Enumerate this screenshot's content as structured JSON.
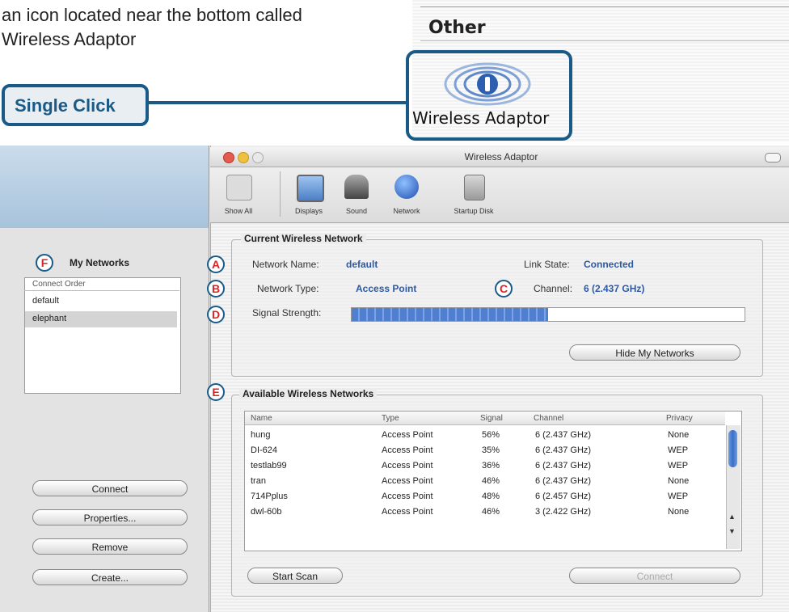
{
  "instruction": {
    "line1": "an icon located near the bottom called",
    "line2": "Wireless Adaptor"
  },
  "callout": {
    "label": "Single Click"
  },
  "inset": {
    "section_title": "Other",
    "icon_label": "Wireless Adaptor",
    "icon_name": "wireless-adaptor-icon"
  },
  "window": {
    "title": "Wireless Adaptor",
    "toolbar": [
      {
        "label": "Show All",
        "icon": "show-all-icon"
      },
      {
        "label": "Displays",
        "icon": "displays-icon"
      },
      {
        "label": "Sound",
        "icon": "sound-icon"
      },
      {
        "label": "Network",
        "icon": "network-icon"
      },
      {
        "label": "Startup Disk",
        "icon": "startup-disk-icon"
      }
    ]
  },
  "my_networks": {
    "marker": "F",
    "title": "My Networks",
    "column_header": "Connect Order",
    "items": [
      "default",
      "elephant"
    ],
    "buttons": [
      "Connect",
      "Properties...",
      "Remove",
      "Create..."
    ]
  },
  "current": {
    "title": "Current Wireless Network",
    "markers": {
      "a": "A",
      "b": "B",
      "c": "C",
      "d": "D"
    },
    "network_name_label": "Network Name:",
    "network_name": "default",
    "link_state_label": "Link State:",
    "link_state": "Connected",
    "network_type_label": "Network Type:",
    "network_type": "Access Point",
    "channel_label": "Channel:",
    "channel": "6 (2.437 GHz)",
    "signal_label": "Signal Strength:",
    "signal_level_fraction": 0.5,
    "hide_button": "Hide My Networks"
  },
  "available": {
    "marker": "E",
    "title": "Available Wireless Networks",
    "columns": [
      "Name",
      "Type",
      "Signal",
      "Channel",
      "Privacy"
    ],
    "rows": [
      [
        "hung",
        "Access Point",
        "56%",
        "6 (2.437 GHz)",
        "None"
      ],
      [
        "DI-624",
        "Access Point",
        "35%",
        "6 (2.437 GHz)",
        "WEP"
      ],
      [
        "testlab99",
        "Access Point",
        "36%",
        "6 (2.437 GHz)",
        "WEP"
      ],
      [
        "tran",
        "Access Point",
        "46%",
        "6 (2.437 GHz)",
        "None"
      ],
      [
        "714Pplus",
        "Access Point",
        "48%",
        "6 (2.457 GHz)",
        "WEP"
      ],
      [
        "dwl-60b",
        "Access Point",
        "46%",
        "3 (2.422 GHz)",
        "None"
      ]
    ],
    "start_scan": "Start Scan",
    "connect": "Connect"
  },
  "colors": {
    "accent": "#1a5a86",
    "marker_text": "#d22222",
    "link_value": "#2b59a6"
  }
}
